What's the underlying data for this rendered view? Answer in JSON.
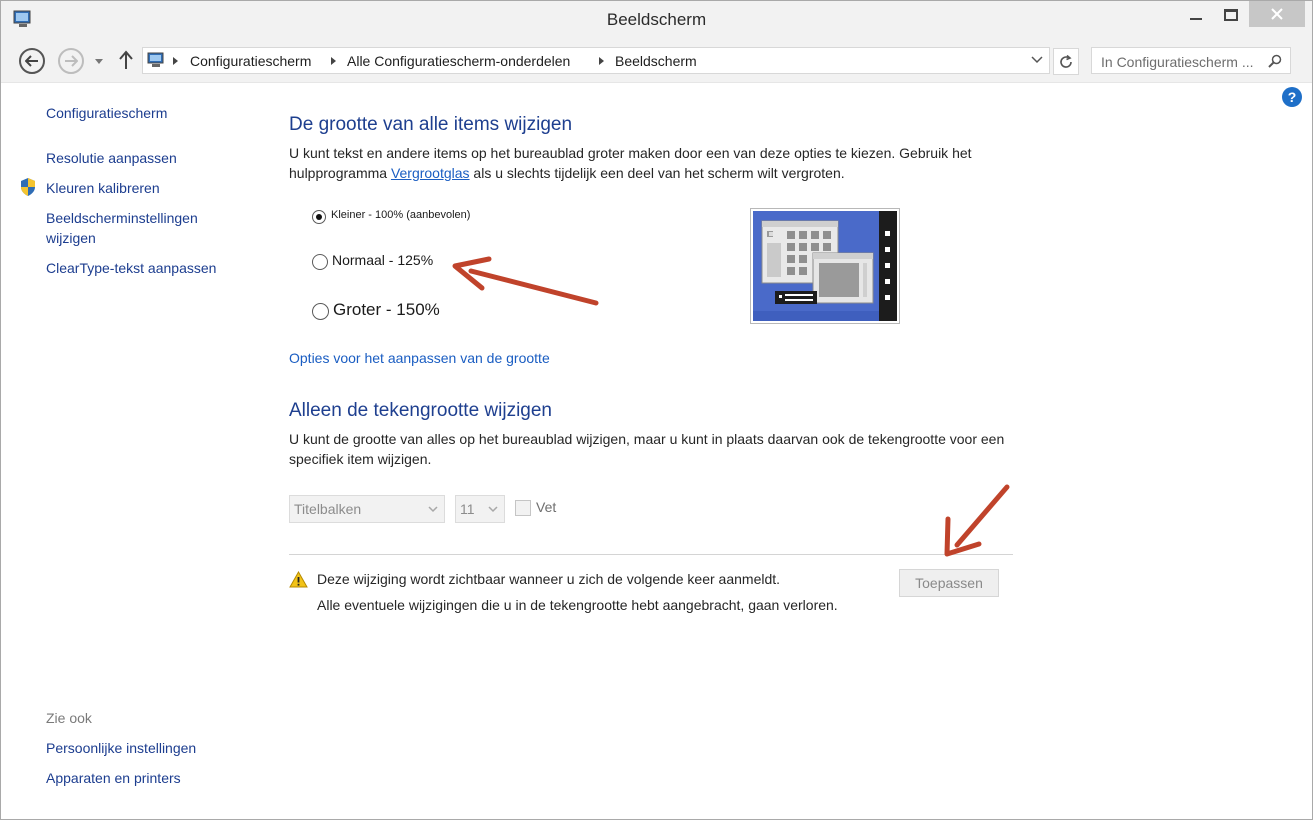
{
  "window": {
    "title": "Beeldscherm"
  },
  "navigation": {
    "breadcrumb": [
      "Configuratiescherm",
      "Alle Configuratiescherm-onderdelen",
      "Beeldscherm"
    ],
    "search_placeholder": "In Configuratiescherm ..."
  },
  "sidebar": {
    "home": "Configuratiescherm",
    "items": [
      "Resolutie aanpassen",
      "Kleuren kalibreren",
      "Beeldscherminstellingen wijzigen",
      "ClearType-tekst aanpassen"
    ],
    "see_also_heading": "Zie ook",
    "see_also": [
      "Persoonlijke instellingen",
      "Apparaten en printers"
    ]
  },
  "section_size": {
    "heading": "De grootte van alle items wijzigen",
    "description_part1": "U kunt tekst en andere items op het bureaublad groter maken door een van deze opties te kiezen. Gebruik het hulpprogramma ",
    "description_link": "Vergrootglas",
    "description_part2": " als u slechts tijdelijk een deel van het scherm wilt vergroten.",
    "options": [
      {
        "label": "Kleiner - 100% (aanbevolen)",
        "selected": true
      },
      {
        "label": "Normaal - 125%",
        "selected": false
      },
      {
        "label": "Groter - 150%",
        "selected": false
      }
    ],
    "options_link": "Opties voor het aanpassen van de grootte"
  },
  "section_font": {
    "heading": "Alleen de tekengrootte wijzigen",
    "description": "U kunt de grootte van alles op het bureaublad wijzigen, maar u kunt in plaats daarvan ook de tekengrootte voor een specifiek item wijzigen.",
    "item_select": "Titelbalken",
    "size_select": "11",
    "bold_label": "Vet"
  },
  "notice": {
    "line1": "Deze wijziging wordt zichtbaar wanneer u zich de volgende keer aanmeldt.",
    "line2": "Alle eventuele wijzigingen die u in de tekengrootte hebt aangebracht, gaan verloren.",
    "apply_label": "Toepassen"
  },
  "colors": {
    "accent": "#1e3f8f",
    "link": "#1a5dc2",
    "annotation_arrow": "#c0432b",
    "help": "#1e6fc8"
  }
}
